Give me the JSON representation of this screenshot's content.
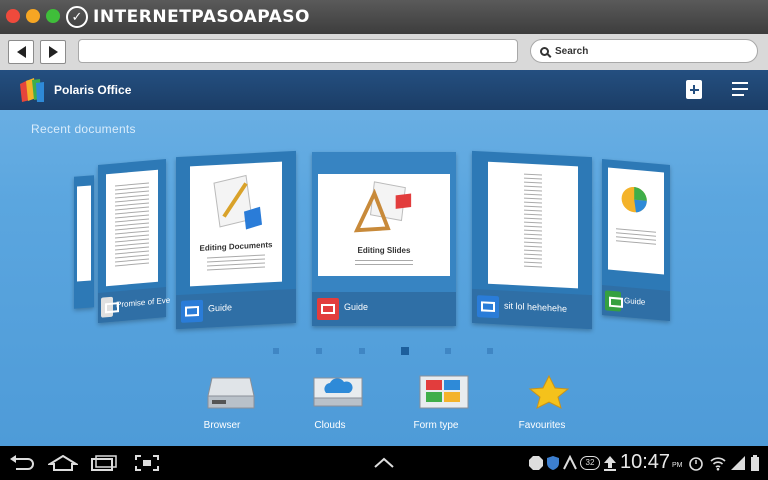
{
  "browser": {
    "site_logo_text": "INTERNETPASOAPASO",
    "url": "",
    "search_placeholder": "Search"
  },
  "app": {
    "title": "Polaris Office",
    "section_label": "Recent documents",
    "cards": [
      {
        "label": "",
        "icon": "doc-icon",
        "thumb_title": ""
      },
      {
        "label": "Promise of Eve",
        "icon": "doc-icon",
        "thumb_title": ""
      },
      {
        "label": "Guide",
        "icon": "word-icon",
        "thumb_title": "Editing Documents"
      },
      {
        "label": "Guide",
        "icon": "powerpoint-icon",
        "thumb_title": "Editing Slides"
      },
      {
        "label": "sit lol hehehehe",
        "icon": "word-icon",
        "thumb_title": ""
      },
      {
        "label": "Guide",
        "icon": "excel-icon",
        "thumb_title": ""
      }
    ],
    "page_count": 6,
    "active_page": 4,
    "tools": [
      {
        "label": "Browser",
        "icon": "drive-icon"
      },
      {
        "label": "Clouds",
        "icon": "cloud-icon"
      },
      {
        "label": "Form type",
        "icon": "form-icon"
      },
      {
        "label": "Favourites",
        "icon": "star-icon"
      }
    ]
  },
  "system": {
    "time": "10:47",
    "meridiem": "PM",
    "notification_count": "32"
  },
  "colors": {
    "app_bg": "#5ba6df",
    "app_bar": "#1b3d66",
    "card": "#2d79b6",
    "word": "#2a7cd8",
    "ppt": "#e23d3d",
    "excel": "#35a040",
    "star": "#f5c21b"
  }
}
